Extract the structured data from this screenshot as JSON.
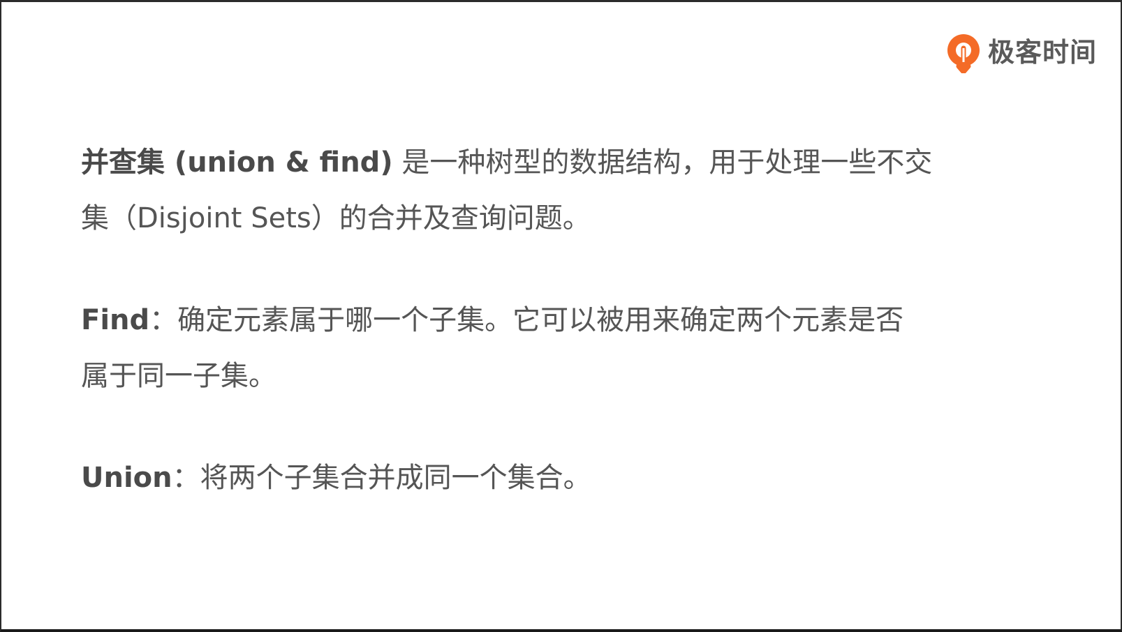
{
  "brand": {
    "name": "极客时间",
    "accent": "#F46B27"
  },
  "paragraphs": [
    {
      "term": "并查集 (union & find)",
      "line1_rest": " 是一种树型的数据结构，用于处理一些不交",
      "line2": "集（Disjoint Sets）的合并及查询问题。"
    },
    {
      "term": "Find",
      "line1_rest": "：确定元素属于哪一个子集。它可以被用来确定两个元素是否",
      "line2": "属于同一子集。"
    },
    {
      "term": "Union",
      "line1_rest": "：将两个子集合并成同一个集合。"
    }
  ]
}
